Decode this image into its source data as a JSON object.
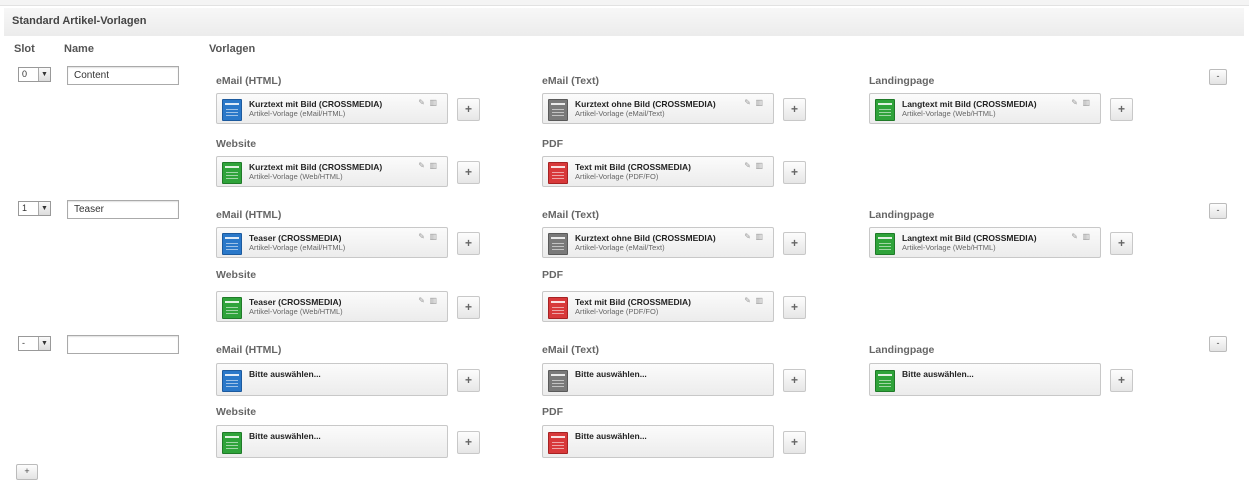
{
  "title": "Standard Artikel-Vorlagen",
  "headers": {
    "slot": "Slot",
    "name": "Name",
    "vorlagen": "Vorlagen"
  },
  "add_row_label": "+",
  "rows": [
    {
      "slot": "0",
      "name": "Content",
      "remove_label": "-",
      "sections": {
        "email_html": {
          "label": "eMail (HTML)",
          "title": "Kurztext mit Bild (CROSSMEDIA)",
          "sub": "Artikel-Vorlage (eMail/HTML)"
        },
        "email_text": {
          "label": "eMail (Text)",
          "title": "Kurztext ohne Bild (CROSSMEDIA)",
          "sub": "Artikel-Vorlage (eMail/Text)"
        },
        "landingpage": {
          "label": "Landingpage",
          "title": "Langtext mit Bild (CROSSMEDIA)",
          "sub": "Artikel-Vorlage (Web/HTML)"
        },
        "website": {
          "label": "Website",
          "title": "Kurztext mit Bild (CROSSMEDIA)",
          "sub": "Artikel-Vorlage (Web/HTML)"
        },
        "pdf": {
          "label": "PDF",
          "title": "Text mit Bild (CROSSMEDIA)",
          "sub": "Artikel-Vorlage (PDF/FO)"
        }
      }
    },
    {
      "slot": "1",
      "name": "Teaser",
      "remove_label": "-",
      "sections": {
        "email_html": {
          "label": "eMail (HTML)",
          "title": "Teaser (CROSSMEDIA)",
          "sub": "Artikel-Vorlage (eMail/HTML)"
        },
        "email_text": {
          "label": "eMail (Text)",
          "title": "Kurztext ohne Bild (CROSSMEDIA)",
          "sub": "Artikel-Vorlage (eMail/Text)"
        },
        "landingpage": {
          "label": "Landingpage",
          "title": "Langtext mit Bild (CROSSMEDIA)",
          "sub": "Artikel-Vorlage (Web/HTML)"
        },
        "website": {
          "label": "Website",
          "title": "Teaser (CROSSMEDIA)",
          "sub": "Artikel-Vorlage (Web/HTML)"
        },
        "pdf": {
          "label": "PDF",
          "title": "Text mit Bild (CROSSMEDIA)",
          "sub": "Artikel-Vorlage (PDF/FO)"
        }
      }
    },
    {
      "slot": "-",
      "name": "",
      "remove_label": "-",
      "sections": {
        "email_html": {
          "label": "eMail (HTML)",
          "title": "Bitte auswählen..."
        },
        "email_text": {
          "label": "eMail (Text)",
          "title": "Bitte auswählen..."
        },
        "landingpage": {
          "label": "Landingpage",
          "title": "Bitte auswählen..."
        },
        "website": {
          "label": "Website",
          "title": "Bitte auswählen..."
        },
        "pdf": {
          "label": "PDF",
          "title": "Bitte auswählen..."
        }
      }
    }
  ],
  "icons": {
    "edit": "pencil-icon",
    "delete": "trash-icon",
    "dropdown": "chevron-down-icon"
  },
  "colors": {
    "email_html": "#2a78c9",
    "email_text": "#7a7a7a",
    "web": "#2fa33a",
    "pdf": "#d8393a"
  }
}
